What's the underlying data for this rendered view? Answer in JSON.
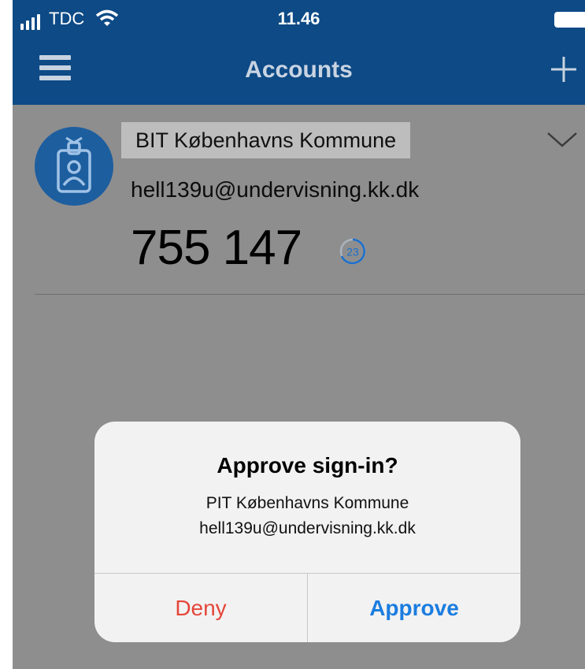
{
  "status_bar": {
    "carrier": "TDC",
    "time": "11.46"
  },
  "nav": {
    "title": "Accounts",
    "menu_icon": "hamburger-menu-icon",
    "add_icon": "plus-icon"
  },
  "account": {
    "name": "BIT Københavns Kommune",
    "email": "hell139u@undervisning.kk.dk",
    "code": "755 147",
    "seconds_remaining": "23",
    "icon": "id-badge-icon"
  },
  "dialog": {
    "title": "Approve sign-in?",
    "org": "PIT Københavns Kommune",
    "email": "hell139u@undervisning.kk.dk",
    "deny_label": "Deny",
    "approve_label": "Approve"
  },
  "colors": {
    "nav_bar": "#0d4a86",
    "overlay_gray": "#8e8e8e",
    "deny": "#e5463a",
    "approve": "#1b7de0"
  }
}
